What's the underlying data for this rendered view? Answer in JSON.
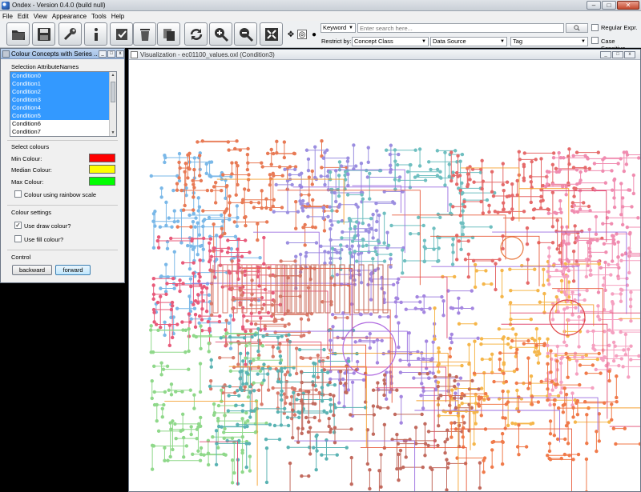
{
  "window": {
    "title": "Ondex - Version 0.4.0 (build null)",
    "min": "–",
    "max": "□",
    "close": "✕"
  },
  "menu": [
    "File",
    "Edit",
    "View",
    "Appearance",
    "Tools",
    "Help"
  ],
  "toolbar": {
    "icons": [
      "open-icon",
      "save-icon",
      "wrench-icon",
      "info-icon",
      "checkbox-icon",
      "trash-icon",
      "copy-icon",
      "refresh-icon",
      "zoom-in-icon",
      "zoom-out-icon",
      "fit-icon"
    ]
  },
  "search": {
    "mode": "Keyword",
    "placeholder": "Enter search here...",
    "restrict_label": "Restrict by:",
    "concept_class": "Concept Class",
    "data_source": "Data Source",
    "tag": "Tag",
    "regular_expr": "Regular Expr.",
    "case_sensitive": "Case Sensitive"
  },
  "panel": {
    "title": "Colour Concepts with Series ...",
    "selection_label": "Selection AttributeNames",
    "items": [
      "Condition0",
      "Condition1",
      "Condition2",
      "Condition3",
      "Condition4",
      "Condition5",
      "Condition6",
      "Condition7"
    ],
    "selected_count": 6,
    "select_colours": "Select colours",
    "min_label": "Min Colour:",
    "median_label": "Median Colour:",
    "max_label": "Max Colour:",
    "min_color": "#ff0000",
    "median_color": "#ffff00",
    "max_color": "#00ff00",
    "rainbow_label": "Colour using rainbow scale",
    "colour_settings": "Colour settings",
    "use_draw": "Use draw colour?",
    "use_fill": "Use fill colour?",
    "control": "Control",
    "backward": "backward",
    "forward": "forward"
  },
  "visualization": {
    "title": "Visualization - ec01100_values.oxl (Condition3)"
  }
}
